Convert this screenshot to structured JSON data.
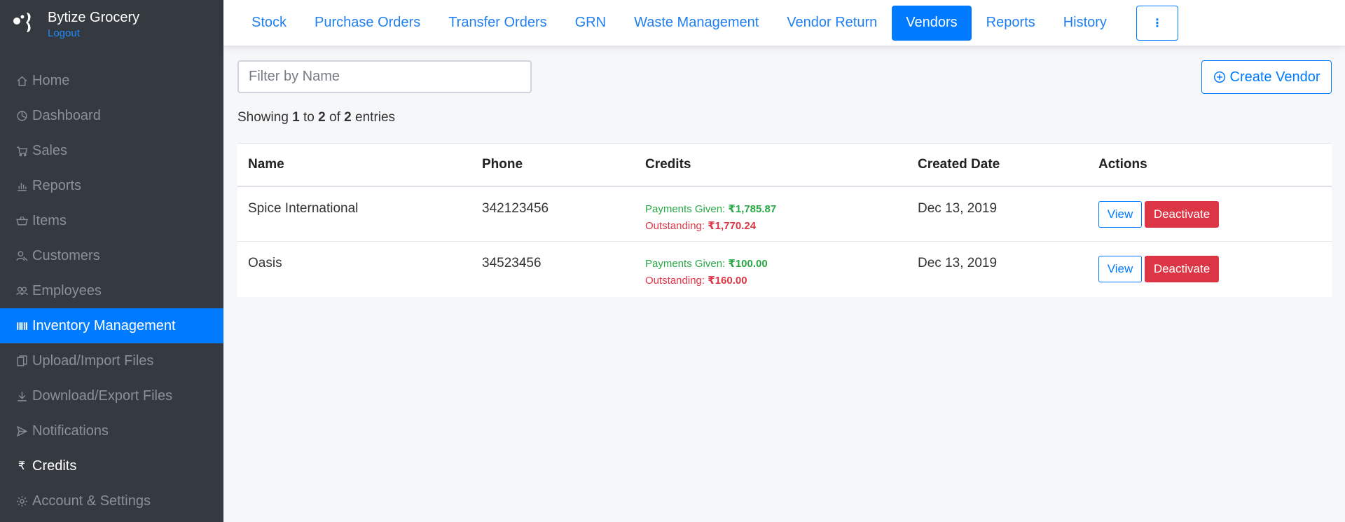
{
  "brand": {
    "name": "Bytize Grocery",
    "logout": "Logout"
  },
  "sidebar": {
    "items": [
      {
        "label": "Home",
        "icon": "home-icon"
      },
      {
        "label": "Dashboard",
        "icon": "dashboard-icon"
      },
      {
        "label": "Sales",
        "icon": "cart-icon"
      },
      {
        "label": "Reports",
        "icon": "bar-chart-icon"
      },
      {
        "label": "Items",
        "icon": "basket-icon"
      },
      {
        "label": "Customers",
        "icon": "customers-icon"
      },
      {
        "label": "Employees",
        "icon": "employees-icon"
      },
      {
        "label": "Inventory Management",
        "icon": "barcode-icon",
        "active": true
      },
      {
        "label": "Upload/Import Files",
        "icon": "files-icon"
      },
      {
        "label": "Download/Export Files",
        "icon": "download-icon"
      },
      {
        "label": "Notifications",
        "icon": "send-icon"
      },
      {
        "label": "Credits",
        "icon": "rupee-icon"
      },
      {
        "label": "Account & Settings",
        "icon": "gear-icon"
      }
    ]
  },
  "tabs": [
    "Stock",
    "Purchase Orders",
    "Transfer Orders",
    "GRN",
    "Waste Management",
    "Vendor Return",
    "Vendors",
    "Reports",
    "History"
  ],
  "active_tab": "Vendors",
  "more_button": "⋮",
  "filter": {
    "placeholder": "Filter by Name",
    "value": ""
  },
  "create_button": "Create Vendor",
  "showing": {
    "prefix": "Showing",
    "from": "1",
    "to_word": "to",
    "to": "2",
    "of_word": "of",
    "total": "2",
    "suffix": "entries"
  },
  "table": {
    "headers": [
      "Name",
      "Phone",
      "Credits",
      "Created Date",
      "Actions"
    ],
    "rows": [
      {
        "name": "Spice International",
        "phone": "342123456",
        "given_label": "Payments Given:",
        "given": "₹1,785.87",
        "out_label": "Outstanding:",
        "outstanding": "₹1,770.24",
        "created": "Dec 13, 2019",
        "view": "View",
        "deactivate": "Deactivate"
      },
      {
        "name": "Oasis",
        "phone": "34523456",
        "given_label": "Payments Given:",
        "given": "₹100.00",
        "out_label": "Outstanding:",
        "outstanding": "₹160.00",
        "created": "Dec 13, 2019",
        "view": "View",
        "deactivate": "Deactivate"
      }
    ]
  },
  "colors": {
    "sidebar_bg": "#343a40",
    "primary": "#007bff",
    "success": "#28a745",
    "danger": "#dc3545"
  }
}
